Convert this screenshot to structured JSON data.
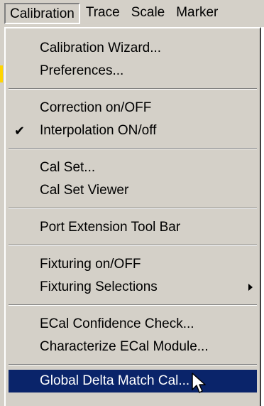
{
  "menubar": {
    "items": [
      "Calibration",
      "Trace",
      "Scale",
      "Marker"
    ]
  },
  "menu": {
    "items": [
      {
        "label": "Calibration Wizard...",
        "mnemonic": "C"
      },
      {
        "label": "Preferences...",
        "mnemonic": "P"
      },
      {
        "label": "Correction on/OFF"
      },
      {
        "label": "Interpolation ON/off",
        "checked": true
      },
      {
        "label": "Cal Set...",
        "mnemonic": "S"
      },
      {
        "label": "Cal Set Viewer",
        "mnemonic": "V"
      },
      {
        "label": "Port Extension Tool Bar",
        "mnemonic": "E"
      },
      {
        "label": "Fixturing on/OFF"
      },
      {
        "label": "Fixturing Selections",
        "mnemonic": "F",
        "submenu": true
      },
      {
        "label": "ECal Confidence Check...",
        "mnemonic": "l"
      },
      {
        "label": "Characterize ECal Module...",
        "mnemonic": "h"
      },
      {
        "label": "Global Delta Match Cal...",
        "highlighted": true
      }
    ]
  },
  "icons": {
    "check": "checkmark-icon",
    "submenu": "submenu-arrow-icon",
    "cursor": "mouse-pointer-icon"
  },
  "colors": {
    "menu_bg": "#d4d0c8",
    "highlight_bg": "#0a246a",
    "highlight_fg": "#ffffff"
  }
}
